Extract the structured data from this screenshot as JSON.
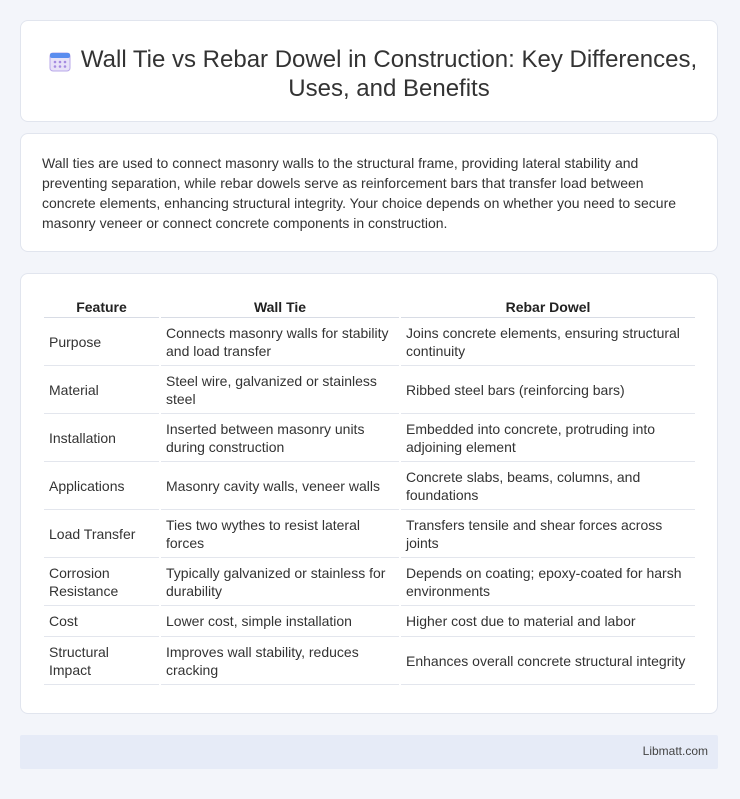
{
  "header": {
    "icon": "calendar-icon",
    "title": "Wall Tie vs Rebar Dowel in Construction: Key Differences, Uses, and Benefits"
  },
  "intro": "Wall ties are used to connect masonry walls to the structural frame, providing lateral stability and preventing separation, while rebar dowels serve as reinforcement bars that transfer load between concrete elements, enhancing structural integrity. Your choice depends on whether you need to secure masonry veneer or connect concrete components in construction.",
  "table": {
    "headers": [
      "Feature",
      "Wall Tie",
      "Rebar Dowel"
    ],
    "rows": [
      [
        "Purpose",
        "Connects masonry walls for stability and load transfer",
        "Joins concrete elements, ensuring structural continuity"
      ],
      [
        "Material",
        "Steel wire, galvanized or stainless steel",
        "Ribbed steel bars (reinforcing bars)"
      ],
      [
        "Installation",
        "Inserted between masonry units during construction",
        "Embedded into concrete, protruding into adjoining element"
      ],
      [
        "Applications",
        "Masonry cavity walls, veneer walls",
        "Concrete slabs, beams, columns, and foundations"
      ],
      [
        "Load Transfer",
        "Ties two wythes to resist lateral forces",
        "Transfers tensile and shear forces across joints"
      ],
      [
        "Corrosion Resistance",
        "Typically galvanized or stainless for durability",
        "Depends on coating; epoxy-coated for harsh environments"
      ],
      [
        "Cost",
        "Lower cost, simple installation",
        "Higher cost due to material and labor"
      ],
      [
        "Structural Impact",
        "Improves wall stability, reduces cracking",
        "Enhances overall concrete structural integrity"
      ]
    ]
  },
  "footer": {
    "brand": "Libmatt.com"
  }
}
